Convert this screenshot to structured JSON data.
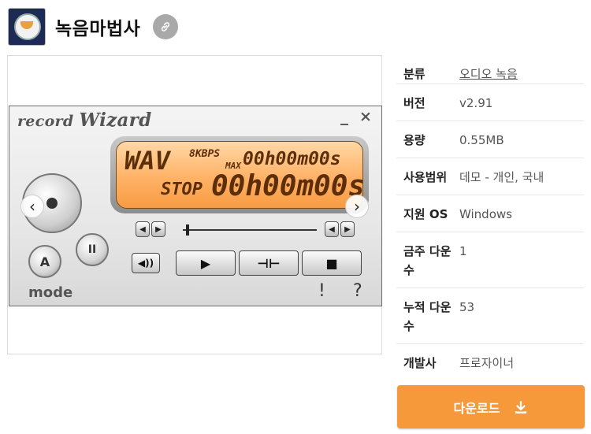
{
  "app": {
    "title": "녹음마법사"
  },
  "screenshot": {
    "window_title_a": "record",
    "window_title_b": "Wizard",
    "minimize_glyph": "_",
    "close_glyph": "×",
    "lcd": {
      "format": "WAV",
      "bitrate": "8KBPS",
      "max_label": "MAX",
      "max_time": "00h00m00s",
      "status": "STOP",
      "time": "00h00m00s"
    },
    "mode_label": "mode",
    "a_label": "A",
    "pause_glyph": "II",
    "play_glyph": "▶",
    "split_glyph": "⊣⊢",
    "save_glyph": "■",
    "vol_glyph": "◀))",
    "seek_back_glyph": "◀",
    "seek_fwd_glyph": "▶",
    "exclamation": "!",
    "question": "?",
    "prev_arrow": "‹",
    "next_arrow": "›"
  },
  "info": {
    "rows": [
      {
        "label": "분류",
        "value": "오디오 녹음"
      },
      {
        "label": "버전",
        "value": "v2.91"
      },
      {
        "label": "용량",
        "value": "0.55MB"
      },
      {
        "label": "사용범위",
        "value": "데모 - 개인, 국내"
      },
      {
        "label": "지원 OS",
        "value": "Windows"
      },
      {
        "label": "금주 다운수",
        "value": "1"
      },
      {
        "label": "누적 다운수",
        "value": "53"
      },
      {
        "label": "개발사",
        "value": "프로자이너"
      }
    ]
  },
  "download": {
    "label": "다운로드"
  },
  "colors": {
    "accent": "#f5993a",
    "link_badge": "#a9a9a9",
    "lcd": "#ffb266"
  },
  "icons": [
    "link-icon",
    "download-icon",
    "app-logo-icon"
  ]
}
